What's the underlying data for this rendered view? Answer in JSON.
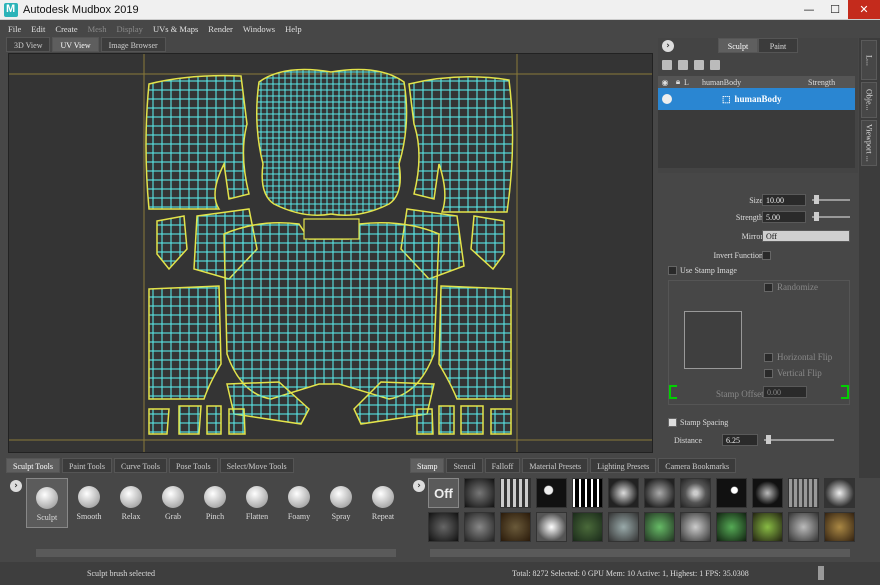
{
  "window": {
    "title": "Autodesk Mudbox 2019"
  },
  "menu": [
    {
      "label": "File",
      "enabled": true
    },
    {
      "label": "Edit",
      "enabled": true
    },
    {
      "label": "Create",
      "enabled": true
    },
    {
      "label": "Mesh",
      "enabled": false
    },
    {
      "label": "Display",
      "enabled": false
    },
    {
      "label": "UVs & Maps",
      "enabled": true
    },
    {
      "label": "Render",
      "enabled": true
    },
    {
      "label": "Windows",
      "enabled": true
    },
    {
      "label": "Help",
      "enabled": true
    }
  ],
  "view_tabs": [
    "3D View",
    "UV View",
    "Image Browser"
  ],
  "active_view_tab": "UV View",
  "mode_tabs": [
    "Sculpt",
    "Paint"
  ],
  "layers": {
    "header_name": "humanBody",
    "header_strength": "Strength",
    "header_lock_label": "L",
    "selected_layer": "humanBody"
  },
  "side_tabs": [
    "L...",
    "Obje...",
    "Viewport ..."
  ],
  "properties": {
    "size_label": "Size",
    "size_value": "10.00",
    "strength_label": "Strength",
    "strength_value": "5.00",
    "mirror_label": "Mirror",
    "mirror_value": "Off",
    "invert_label": "Invert Function",
    "use_stamp_label": "Use Stamp Image",
    "randomize_label": "Randomize",
    "hflip_label": "Horizontal Flip",
    "vflip_label": "Vertical Flip",
    "stamp_offset_label": "Stamp Offset",
    "stamp_offset_value": "0.00",
    "stamp_spacing_label": "Stamp Spacing",
    "distance_label": "Distance",
    "distance_value": "6.25"
  },
  "tool_tabs": [
    "Sculpt Tools",
    "Paint Tools",
    "Curve Tools",
    "Pose Tools",
    "Select/Move Tools"
  ],
  "tools": [
    "Sculpt",
    "Smooth",
    "Relax",
    "Grab",
    "Pinch",
    "Flatten",
    "Foamy",
    "Spray",
    "Repeat"
  ],
  "stamp_tabs": [
    "Stamp",
    "Stencil",
    "Falloff",
    "Material Presets",
    "Lighting Presets",
    "Camera Bookmarks"
  ],
  "stamp_off_label": "Off",
  "status": {
    "left": "Sculpt brush selected",
    "right": "Total: 8272  Selected: 0 GPU Mem: 10  Active: 1, Highest: 1  FPS: 35.0308"
  },
  "colors": {
    "uv_grid": "#59e6e6",
    "uv_border": "#e3e34a",
    "selection": "#2a86d2",
    "stamp_bracket": "#00d000"
  }
}
